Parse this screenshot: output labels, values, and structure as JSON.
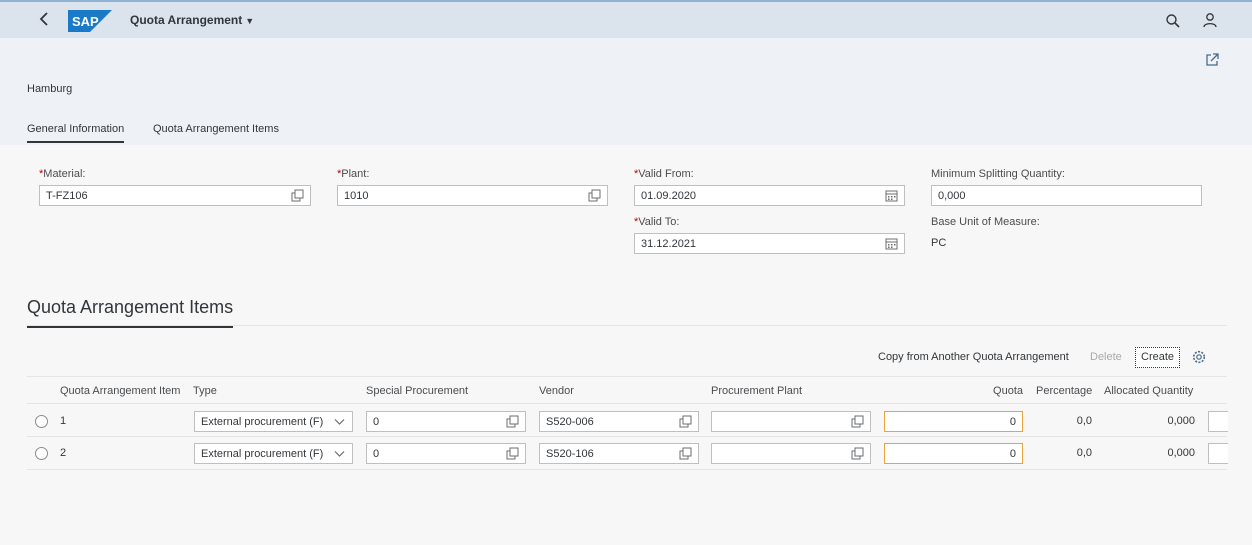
{
  "shell": {
    "app_title": "Quota Arrangement",
    "logo_text": "SAP"
  },
  "header": {
    "object_title": "Hamburg",
    "tabs": [
      {
        "label": "General Information",
        "active": true
      },
      {
        "label": "Quota Arrangement Items",
        "active": false
      }
    ]
  },
  "form": {
    "material": {
      "label": "Material:",
      "value": "T-FZ106",
      "required": true
    },
    "plant": {
      "label": "Plant:",
      "value": "1010",
      "required": true
    },
    "valid_from": {
      "label": "Valid From:",
      "value": "01.09.2020",
      "required": true
    },
    "valid_to": {
      "label": "Valid To:",
      "value": "31.12.2021",
      "required": true
    },
    "min_split_qty": {
      "label": "Minimum Splitting Quantity:",
      "value": "0,000"
    },
    "base_uom": {
      "label": "Base Unit of Measure:",
      "value": "PC"
    },
    "required_marker": "*"
  },
  "items_section": {
    "title": "Quota Arrangement Items",
    "toolbar": {
      "copy_label": "Copy from Another Quota Arrangement",
      "delete_label": "Delete",
      "create_label": "Create"
    },
    "columns": [
      "Quota Arrangement Item",
      "Type",
      "Special Procurement",
      "Vendor",
      "Procurement Plant",
      "Quota",
      "Percentage",
      "Allocated Quantity"
    ],
    "rows": [
      {
        "item": "1",
        "type": "External procurement (F)",
        "special_procurement": "0",
        "vendor": "S520-006",
        "procurement_plant": "",
        "quota": "0",
        "percentage": "0,0",
        "allocated_quantity": "0,000"
      },
      {
        "item": "2",
        "type": "External procurement (F)",
        "special_procurement": "0",
        "vendor": "S520-106",
        "procurement_plant": "",
        "quota": "0",
        "percentage": "0,0",
        "allocated_quantity": "0,000"
      }
    ]
  },
  "colors": {
    "shell_bg": "#dbe3ec",
    "required": "#bb0000",
    "quota_border": "#e9a53c",
    "sap_blue": "#1a7ac8"
  }
}
